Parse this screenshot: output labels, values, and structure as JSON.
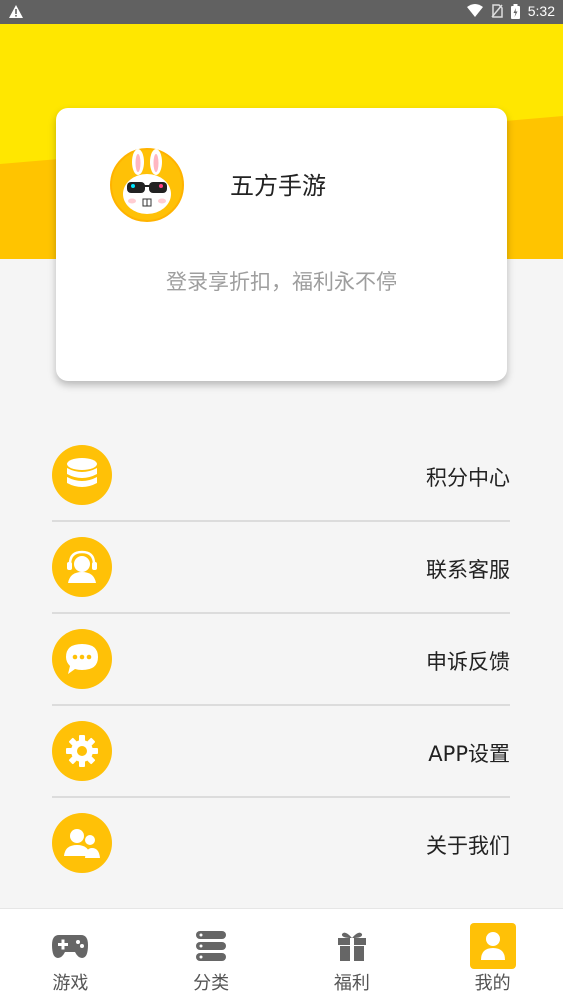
{
  "status_bar": {
    "time": "5:32"
  },
  "profile": {
    "app_name": "五方手游",
    "slogan": "登录享折扣，福利永不停"
  },
  "menu": {
    "items": [
      {
        "label": "积分中心",
        "icon": "coins-stack-icon"
      },
      {
        "label": "联系客服",
        "icon": "customer-service-icon"
      },
      {
        "label": "申诉反馈",
        "icon": "chat-bubble-icon"
      },
      {
        "label": "APP设置",
        "icon": "gear-icon"
      },
      {
        "label": "关于我们",
        "icon": "people-icon"
      }
    ]
  },
  "bottom_nav": {
    "items": [
      {
        "label": "游戏",
        "icon": "gamepad-icon"
      },
      {
        "label": "分类",
        "icon": "category-icon"
      },
      {
        "label": "福利",
        "icon": "gift-icon"
      },
      {
        "label": "我的",
        "icon": "user-icon",
        "active": true
      }
    ]
  },
  "colors": {
    "accent": "#ffc107",
    "header": "#ffe700"
  }
}
